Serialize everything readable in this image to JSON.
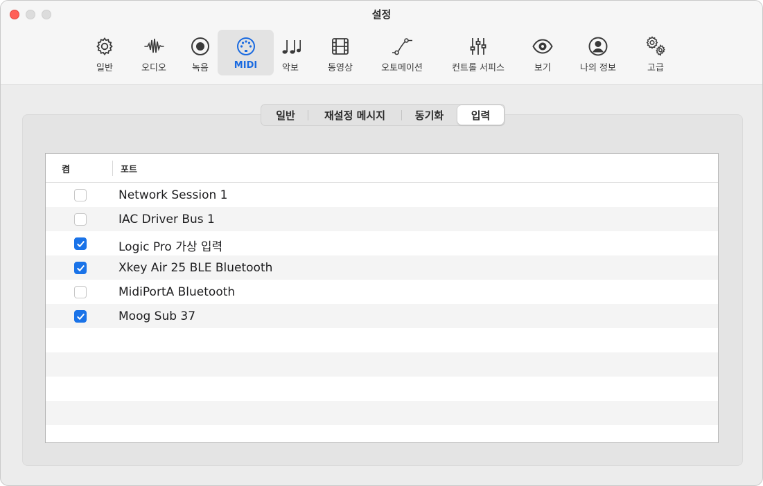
{
  "window": {
    "title": "설정"
  },
  "toolbar": {
    "items": [
      {
        "label": "일반",
        "icon": "gear-icon"
      },
      {
        "label": "오디오",
        "icon": "waveform-icon"
      },
      {
        "label": "녹음",
        "icon": "record-icon"
      },
      {
        "label": "MIDI",
        "icon": "midi-connector-icon",
        "active": true
      },
      {
        "label": "악보",
        "icon": "music-notes-icon"
      },
      {
        "label": "동영상",
        "icon": "film-icon"
      },
      {
        "label": "오토메이션",
        "icon": "automation-curve-icon"
      },
      {
        "label": "컨트롤 서피스",
        "icon": "sliders-icon"
      },
      {
        "label": "보기",
        "icon": "eye-icon"
      },
      {
        "label": "나의 정보",
        "icon": "person-icon"
      },
      {
        "label": "고급",
        "icon": "gears-icon"
      }
    ]
  },
  "tabs": {
    "items": [
      "일반",
      "재설정 메시지",
      "동기화",
      "입력"
    ],
    "selected": "입력"
  },
  "ports_table": {
    "col_on": "켬",
    "col_port": "포트",
    "rows": [
      {
        "name": "Network Session 1",
        "checked": false
      },
      {
        "name": "IAC Driver Bus 1",
        "checked": false
      },
      {
        "name": "Logic Pro 가상 입력",
        "checked": true
      },
      {
        "name": "Xkey Air 25 BLE Bluetooth",
        "checked": true
      },
      {
        "name": "MidiPortA Bluetooth",
        "checked": false
      },
      {
        "name": "Moog Sub 37",
        "checked": true
      }
    ]
  },
  "colors": {
    "accent": "#1a73e8",
    "close": "#ff5f57"
  }
}
